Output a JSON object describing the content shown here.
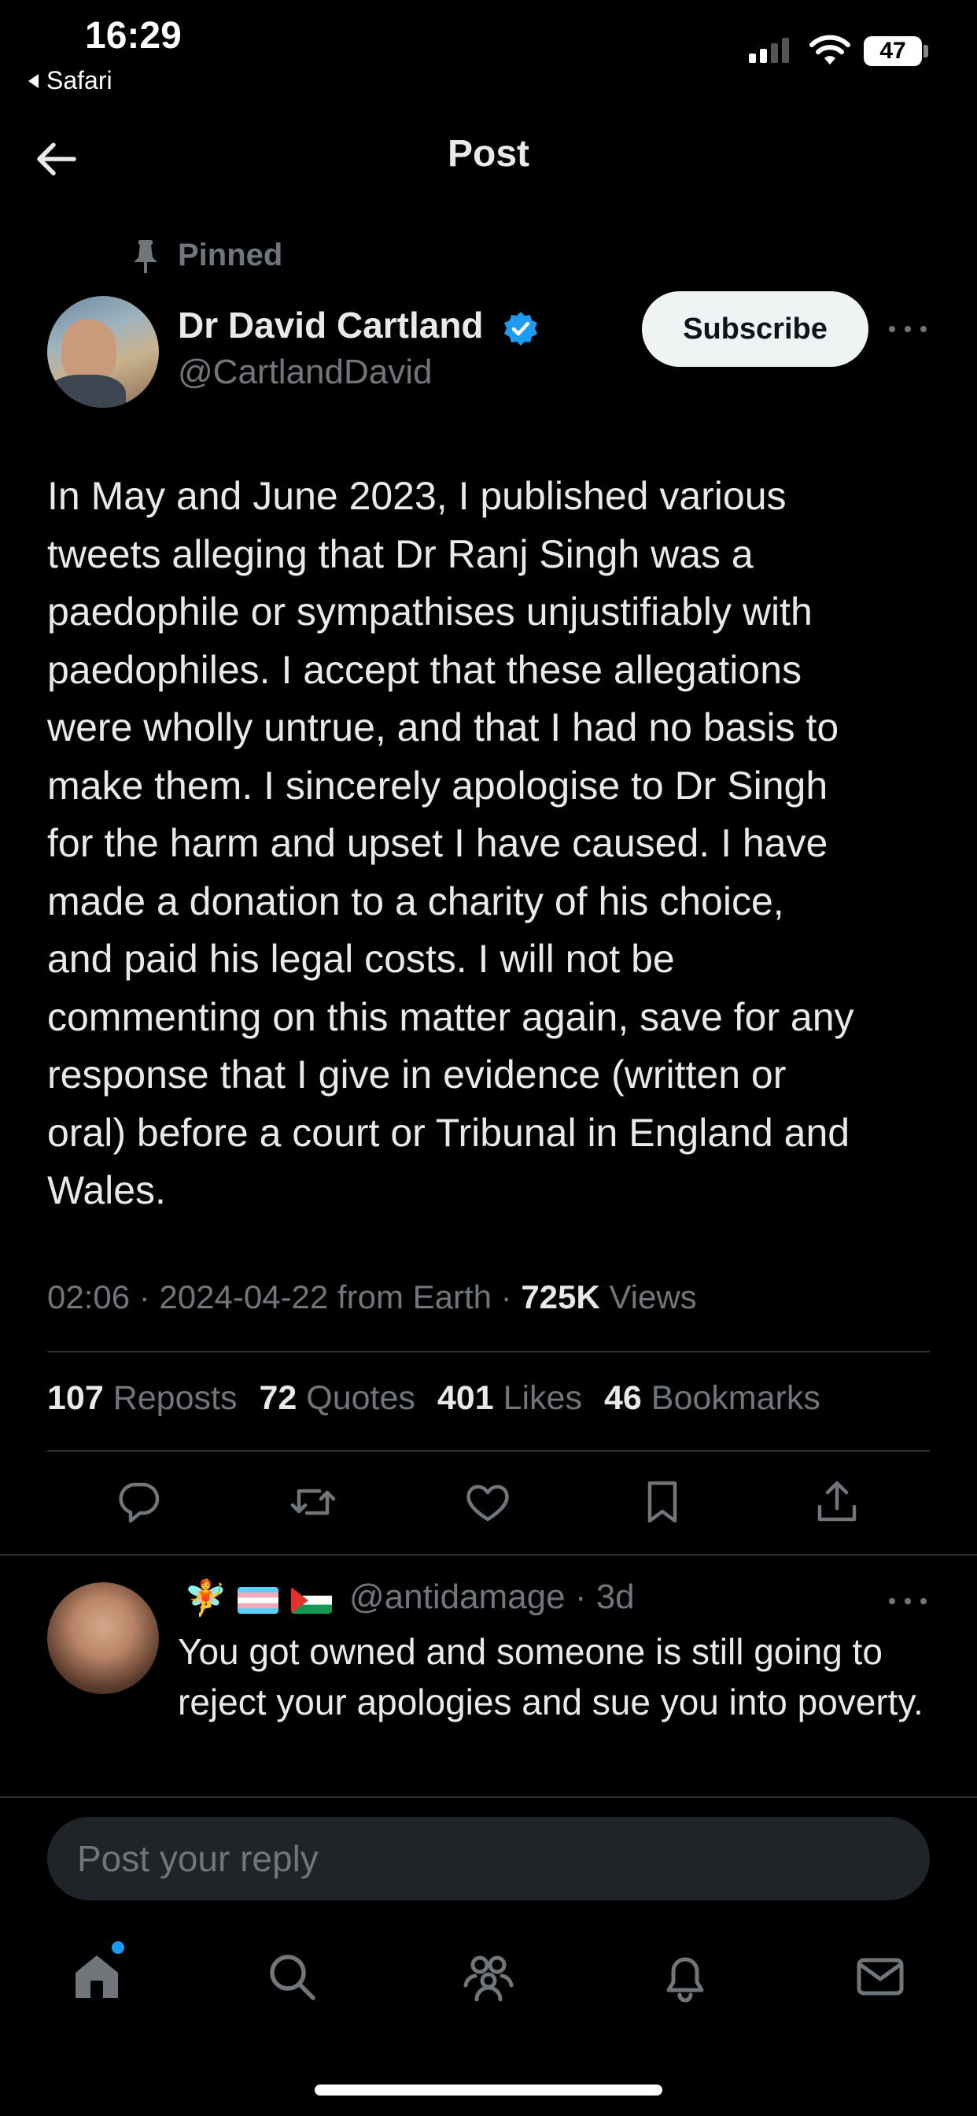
{
  "status_bar": {
    "time": "16:29",
    "back_app": "Safari",
    "battery": "47"
  },
  "header": {
    "title": "Post",
    "back_icon": "arrow-left-icon"
  },
  "post": {
    "pinned_label": "Pinned",
    "author_name": "Dr David Cartland",
    "author_handle": "@CartlandDavid",
    "verified": true,
    "verified_color": "#1d9bf0",
    "subscribe_label": "Subscribe",
    "body": "In May and June 2023, I published various\ntweets alleging that Dr Ranj Singh was a\npaedophile or sympathises unjustifiably with\npaedophiles. I accept that these allegations\nwere wholly untrue, and that I had no basis to\nmake them. I sincerely apologise to Dr Singh\nfor the harm and upset I have caused. I have\nmade a donation to a charity of his choice,\nand paid his legal costs. I will not be\ncommenting on this matter again, save for any\nresponse that I give in evidence (written or\noral) before a court or Tribunal in England and\nWales.",
    "meta_time": "02:06 · 2024-04-22 from Earth · ",
    "views_count": "725K",
    "views_label": " Views",
    "stats": {
      "reposts_count": "107",
      "reposts_label": "Reposts",
      "quotes_count": "72",
      "quotes_label": "Quotes",
      "likes_count": "401",
      "likes_label": "Likes",
      "bookmarks_count": "46",
      "bookmarks_label": "Bookmarks"
    },
    "actions": [
      "reply-icon",
      "repost-icon",
      "like-icon",
      "bookmark-icon",
      "share-icon"
    ]
  },
  "reply": {
    "handle_line": "@antidamage · 3d",
    "emoji": "🧚",
    "flags": [
      "transgender-flag",
      "palestine-flag"
    ],
    "text": "You got owned and someone is still going to reject your apologies and sue you into poverty."
  },
  "composer": {
    "placeholder": "Post your reply"
  },
  "tab_bar": [
    "home-icon",
    "search-icon",
    "communities-icon",
    "notifications-icon",
    "messages-icon"
  ],
  "colors": {
    "background": "#000000",
    "text": "#e7e9ea",
    "secondary": "#71767b",
    "accent": "#1d9bf0"
  }
}
